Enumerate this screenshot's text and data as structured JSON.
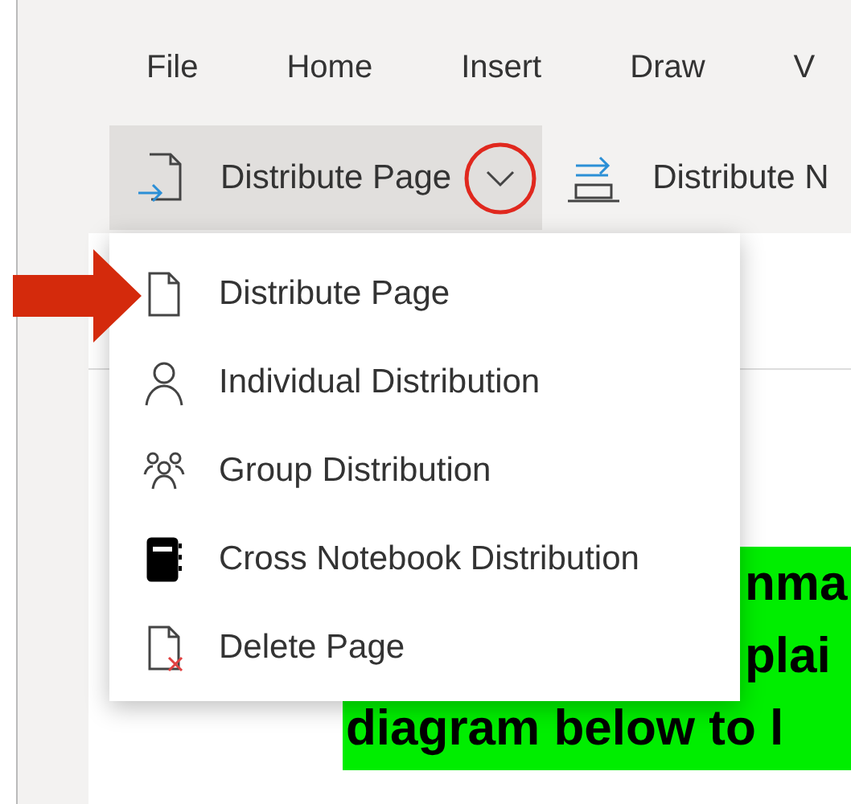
{
  "tabs": [
    {
      "label": "File"
    },
    {
      "label": "Home"
    },
    {
      "label": "Insert"
    },
    {
      "label": "Draw"
    },
    {
      "label": "V"
    }
  ],
  "ribbon": {
    "buttons": [
      {
        "label": "Distribute Page",
        "kind": "split",
        "pressed": true,
        "circled": true
      },
      {
        "label": "Distribute N",
        "kind": "plain",
        "pressed": false,
        "circled": false
      }
    ]
  },
  "menu": {
    "items": [
      {
        "label": "Distribute Page",
        "kind": "page",
        "pointed": true
      },
      {
        "label": "Individual Distribution",
        "kind": "person",
        "pointed": false
      },
      {
        "label": "Group Distribution",
        "kind": "group",
        "pointed": false
      },
      {
        "label": "Cross Notebook Distribution",
        "kind": "notebook",
        "pointed": false
      },
      {
        "label": "Delete Page",
        "kind": "delete",
        "pointed": false
      }
    ]
  },
  "page": {
    "highlighted_lines": [
      {
        "text": "nma",
        "kind": "partial"
      },
      {
        "text": "plai",
        "kind": "partial"
      },
      {
        "text": "diagram below to l",
        "kind": "full"
      }
    ]
  }
}
